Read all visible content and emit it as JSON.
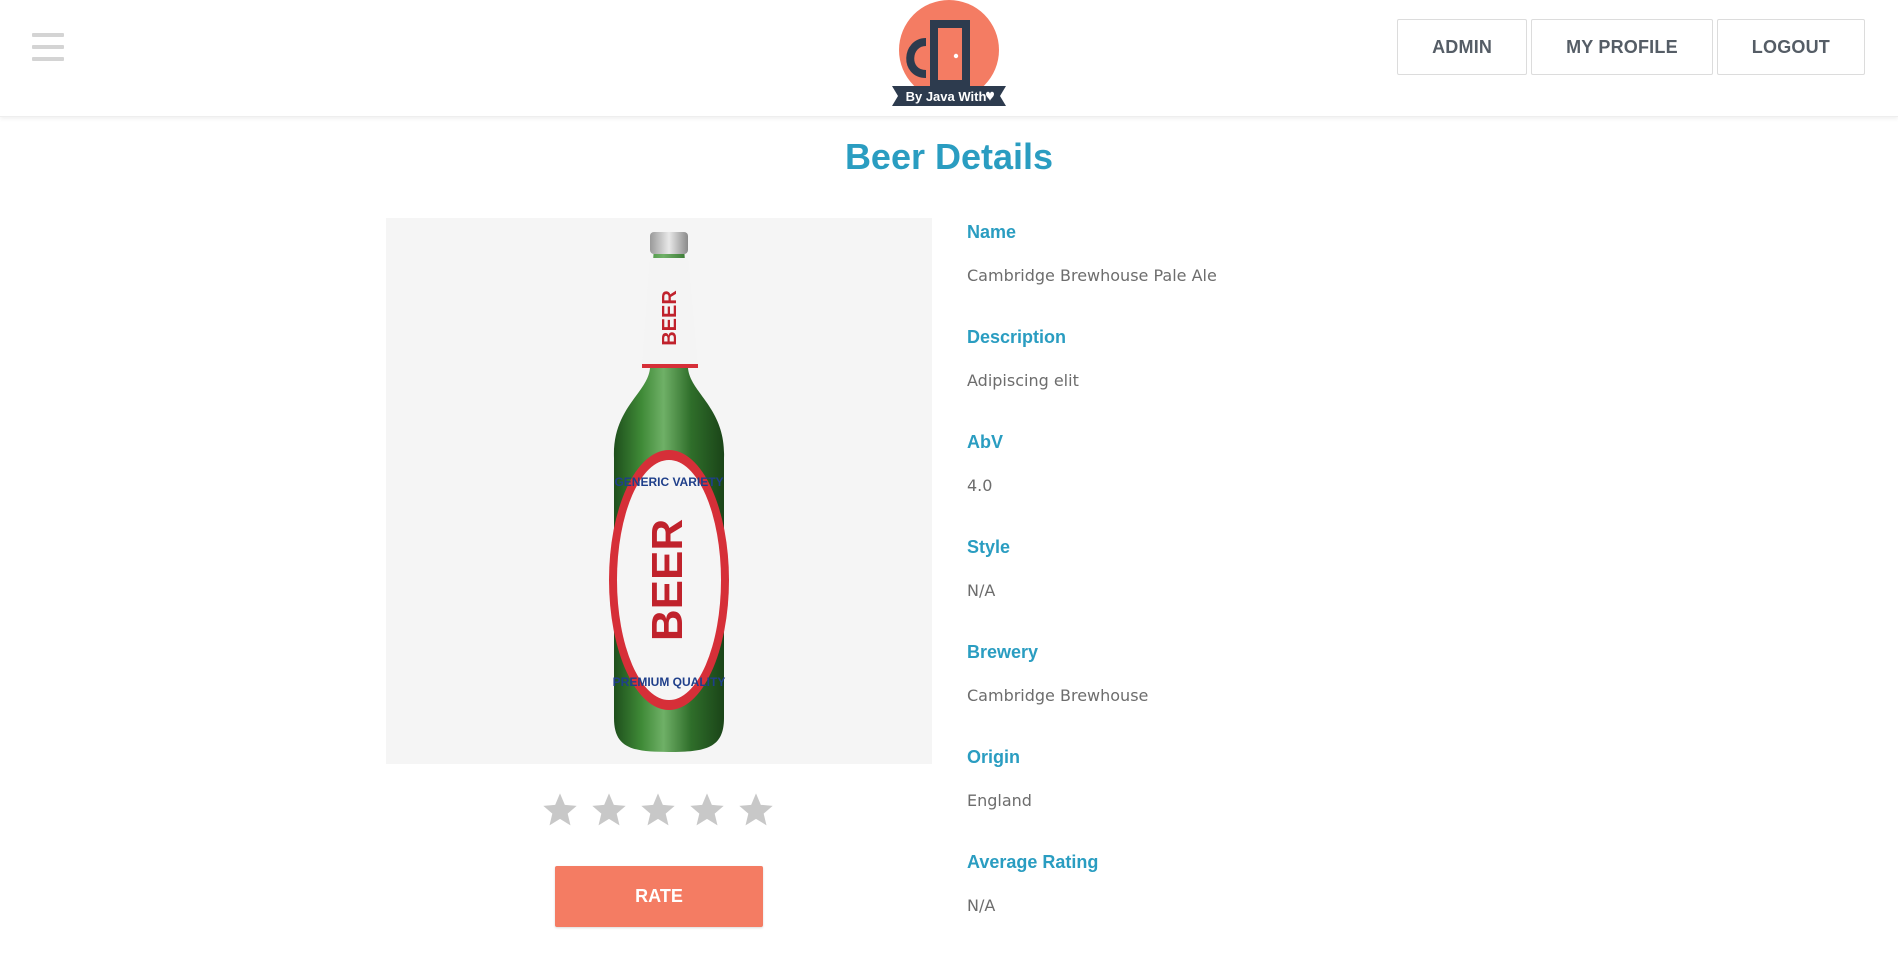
{
  "header": {
    "logo_caption": "By Java With",
    "nav": [
      {
        "label": "ADMIN"
      },
      {
        "label": "MY PROFILE"
      },
      {
        "label": "LOGOUT"
      }
    ]
  },
  "page": {
    "title": "Beer Details"
  },
  "product_image": {
    "neck_label_text": "BEER",
    "body_label_top": "GENERIC VARIETY",
    "body_label_main": "BEER",
    "body_label_bottom": "PREMIUM QUALITY"
  },
  "rating": {
    "stars_total": 5,
    "stars_selected": 0,
    "rate_label": "RATE"
  },
  "details": [
    {
      "label": "Name",
      "value": "Cambridge Brewhouse Pale Ale"
    },
    {
      "label": "Description",
      "value": "Adipiscing elit"
    },
    {
      "label": "AbV",
      "value": "4.0"
    },
    {
      "label": "Style",
      "value": "N/A"
    },
    {
      "label": "Brewery",
      "value": "Cambridge Brewhouse"
    },
    {
      "label": "Origin",
      "value": "England"
    },
    {
      "label": "Average Rating",
      "value": "N/A"
    }
  ],
  "colors": {
    "accent": "#2a9dc1",
    "button": "#f47c63",
    "logo_circle": "#f47c63",
    "logo_dark": "#2d3b4e",
    "star_empty": "#c8c8c8",
    "bottle_green": "#2f6e2a"
  }
}
